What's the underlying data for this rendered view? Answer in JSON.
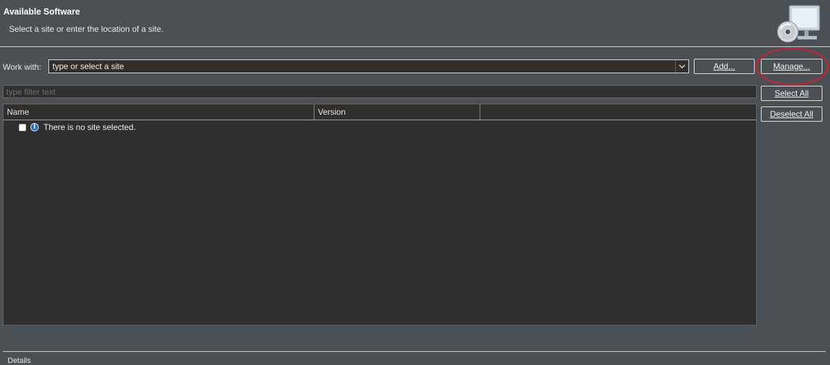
{
  "header": {
    "title": "Available Software",
    "description": "Select a site or enter the location of a site."
  },
  "work_with": {
    "label": "Work with:",
    "value": "type or select a site"
  },
  "buttons": {
    "add": "Add...",
    "manage": "Manage...",
    "select_all": "Select All",
    "deselect_all": "Deselect All"
  },
  "filter": {
    "placeholder": "type filter text"
  },
  "table": {
    "columns": [
      "Name",
      "Version"
    ],
    "rows": [
      {
        "checked": false,
        "icon": "info-icon",
        "text": "There is no site selected."
      }
    ]
  },
  "details": {
    "label": "Details"
  },
  "colors": {
    "background": "#4b5055",
    "field_background": "#2f2f2f",
    "annotation": "#d0202a",
    "info_icon": "#2a6bc2"
  }
}
